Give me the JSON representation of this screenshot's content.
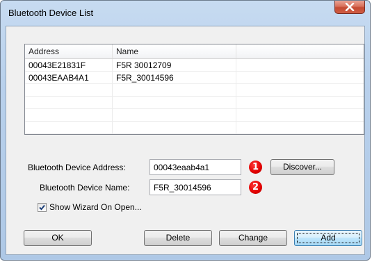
{
  "window": {
    "title": "Bluetooth Device List",
    "close_glyph": "X"
  },
  "list": {
    "columns": [
      "Address",
      "Name"
    ],
    "rows": [
      {
        "address": "00043E21831F",
        "name": "F5R 30012709"
      },
      {
        "address": "00043EAAB4A1",
        "name": "F5R_30014596"
      }
    ]
  },
  "fields": {
    "address_label": "Bluetooth Device Address:",
    "address_value": "00043eaab4a1",
    "name_label": "Bluetooth Device Name:",
    "name_value": "F5R_30014596",
    "discover_label": "Discover..."
  },
  "badges": [
    "1",
    "2"
  ],
  "checkbox": {
    "label": "Show Wizard On Open...",
    "checked": true
  },
  "buttons": {
    "ok": "OK",
    "delete": "Delete",
    "change": "Change",
    "add": "Add"
  },
  "colors": {
    "badge": "#e00000",
    "close_button": "#c44a32",
    "default_button_border": "#3c7fb1"
  }
}
